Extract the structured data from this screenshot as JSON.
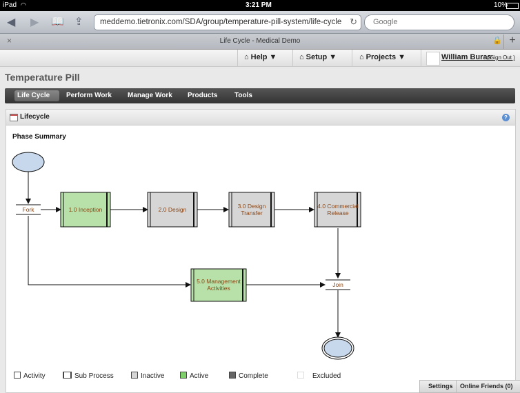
{
  "status_bar": {
    "device": "iPad",
    "wifi_icon": "wifi-icon",
    "time": "3:21 PM",
    "battery": "10%"
  },
  "browser": {
    "url": "meddemo.tietronix.com/SDA/group/temperature-pill-system/life-cycle",
    "search_placeholder": "Google",
    "tab_title": "Life Cycle - Medical Demo",
    "tab_close": "×",
    "new_tab": "+"
  },
  "app_nav": {
    "help": "Help",
    "setup": "Setup",
    "projects": "Projects",
    "user_name": "William Buras",
    "sign_out": "( Sign Out )"
  },
  "page_title": "Temperature Pill",
  "main_menu": [
    "Life Cycle",
    "Perform Work",
    "Manage Work",
    "Products",
    "Tools"
  ],
  "panel": {
    "title": "Lifecycle",
    "subtitle": "Phase Summary",
    "help": "?"
  },
  "diagram": {
    "fork": "Fork",
    "join": "Join",
    "nodes": {
      "inception": "1.0 Inception",
      "design": "2.0 Design",
      "design_transfer_l1": "3.0 Design",
      "design_transfer_l2": "Transfer",
      "commercial_l1": "4.0 Commercial",
      "commercial_l2": "Release",
      "management_l1": "5.0 Management",
      "management_l2": "Activities"
    },
    "colors": {
      "active": "#b7e1a8",
      "inactive": "#d6d6d6",
      "terminal": "#c7d8ec"
    }
  },
  "legend": {
    "activity": "Activity",
    "sub_process": "Sub Process",
    "inactive": "Inactive",
    "active": "Active",
    "complete": "Complete",
    "excluded": "Excluded"
  },
  "bottom_bar": {
    "settings": "Settings",
    "online_friends": "Online Friends (0)"
  }
}
